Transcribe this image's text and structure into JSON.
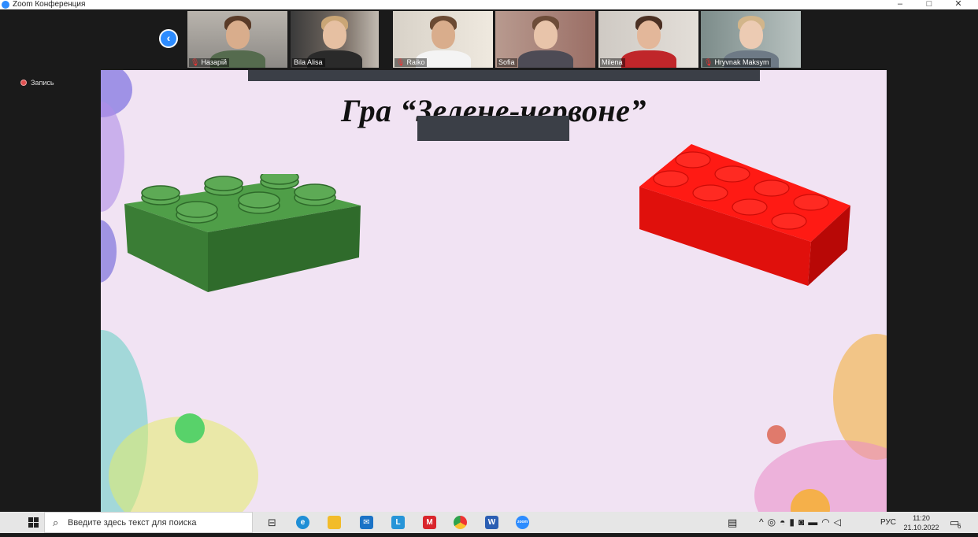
{
  "window": {
    "title": "Zoom Конференция",
    "controls": {
      "minimize": "–",
      "maximize": "□",
      "close": "✕"
    }
  },
  "meeting": {
    "recording_label": "Запись",
    "prev_page_icon": "chevron-left-icon",
    "participants": [
      {
        "name": "Назарій",
        "muted": true
      },
      {
        "name": "Bila Alisa",
        "muted": false
      },
      {
        "name": "Raiko",
        "muted": true
      },
      {
        "name": "Sofia",
        "muted": false
      },
      {
        "name": "Milena",
        "muted": false
      },
      {
        "name": "Hryvnak Maksym",
        "muted": true
      }
    ]
  },
  "slide": {
    "title": "Гра “Зелене-червоне”",
    "left_object": "green-lego-brick",
    "right_object": "red-lego-brick",
    "colors": {
      "background": "#f1e3f3",
      "green_brick": "#3f8a3a",
      "red_brick": "#e8120f"
    }
  },
  "taskbar": {
    "search_placeholder": "Введите здесь текст для поиска",
    "apps": [
      "task-view-icon",
      "edge-icon",
      "file-explorer-icon",
      "mail-icon",
      "l-app-icon",
      "mcafee-icon",
      "chrome-icon",
      "word-icon",
      "zoom-icon"
    ],
    "tray": {
      "language": "РУС"
    },
    "time": "11:20",
    "date": "21.10.2022",
    "notifications_count": "6"
  }
}
